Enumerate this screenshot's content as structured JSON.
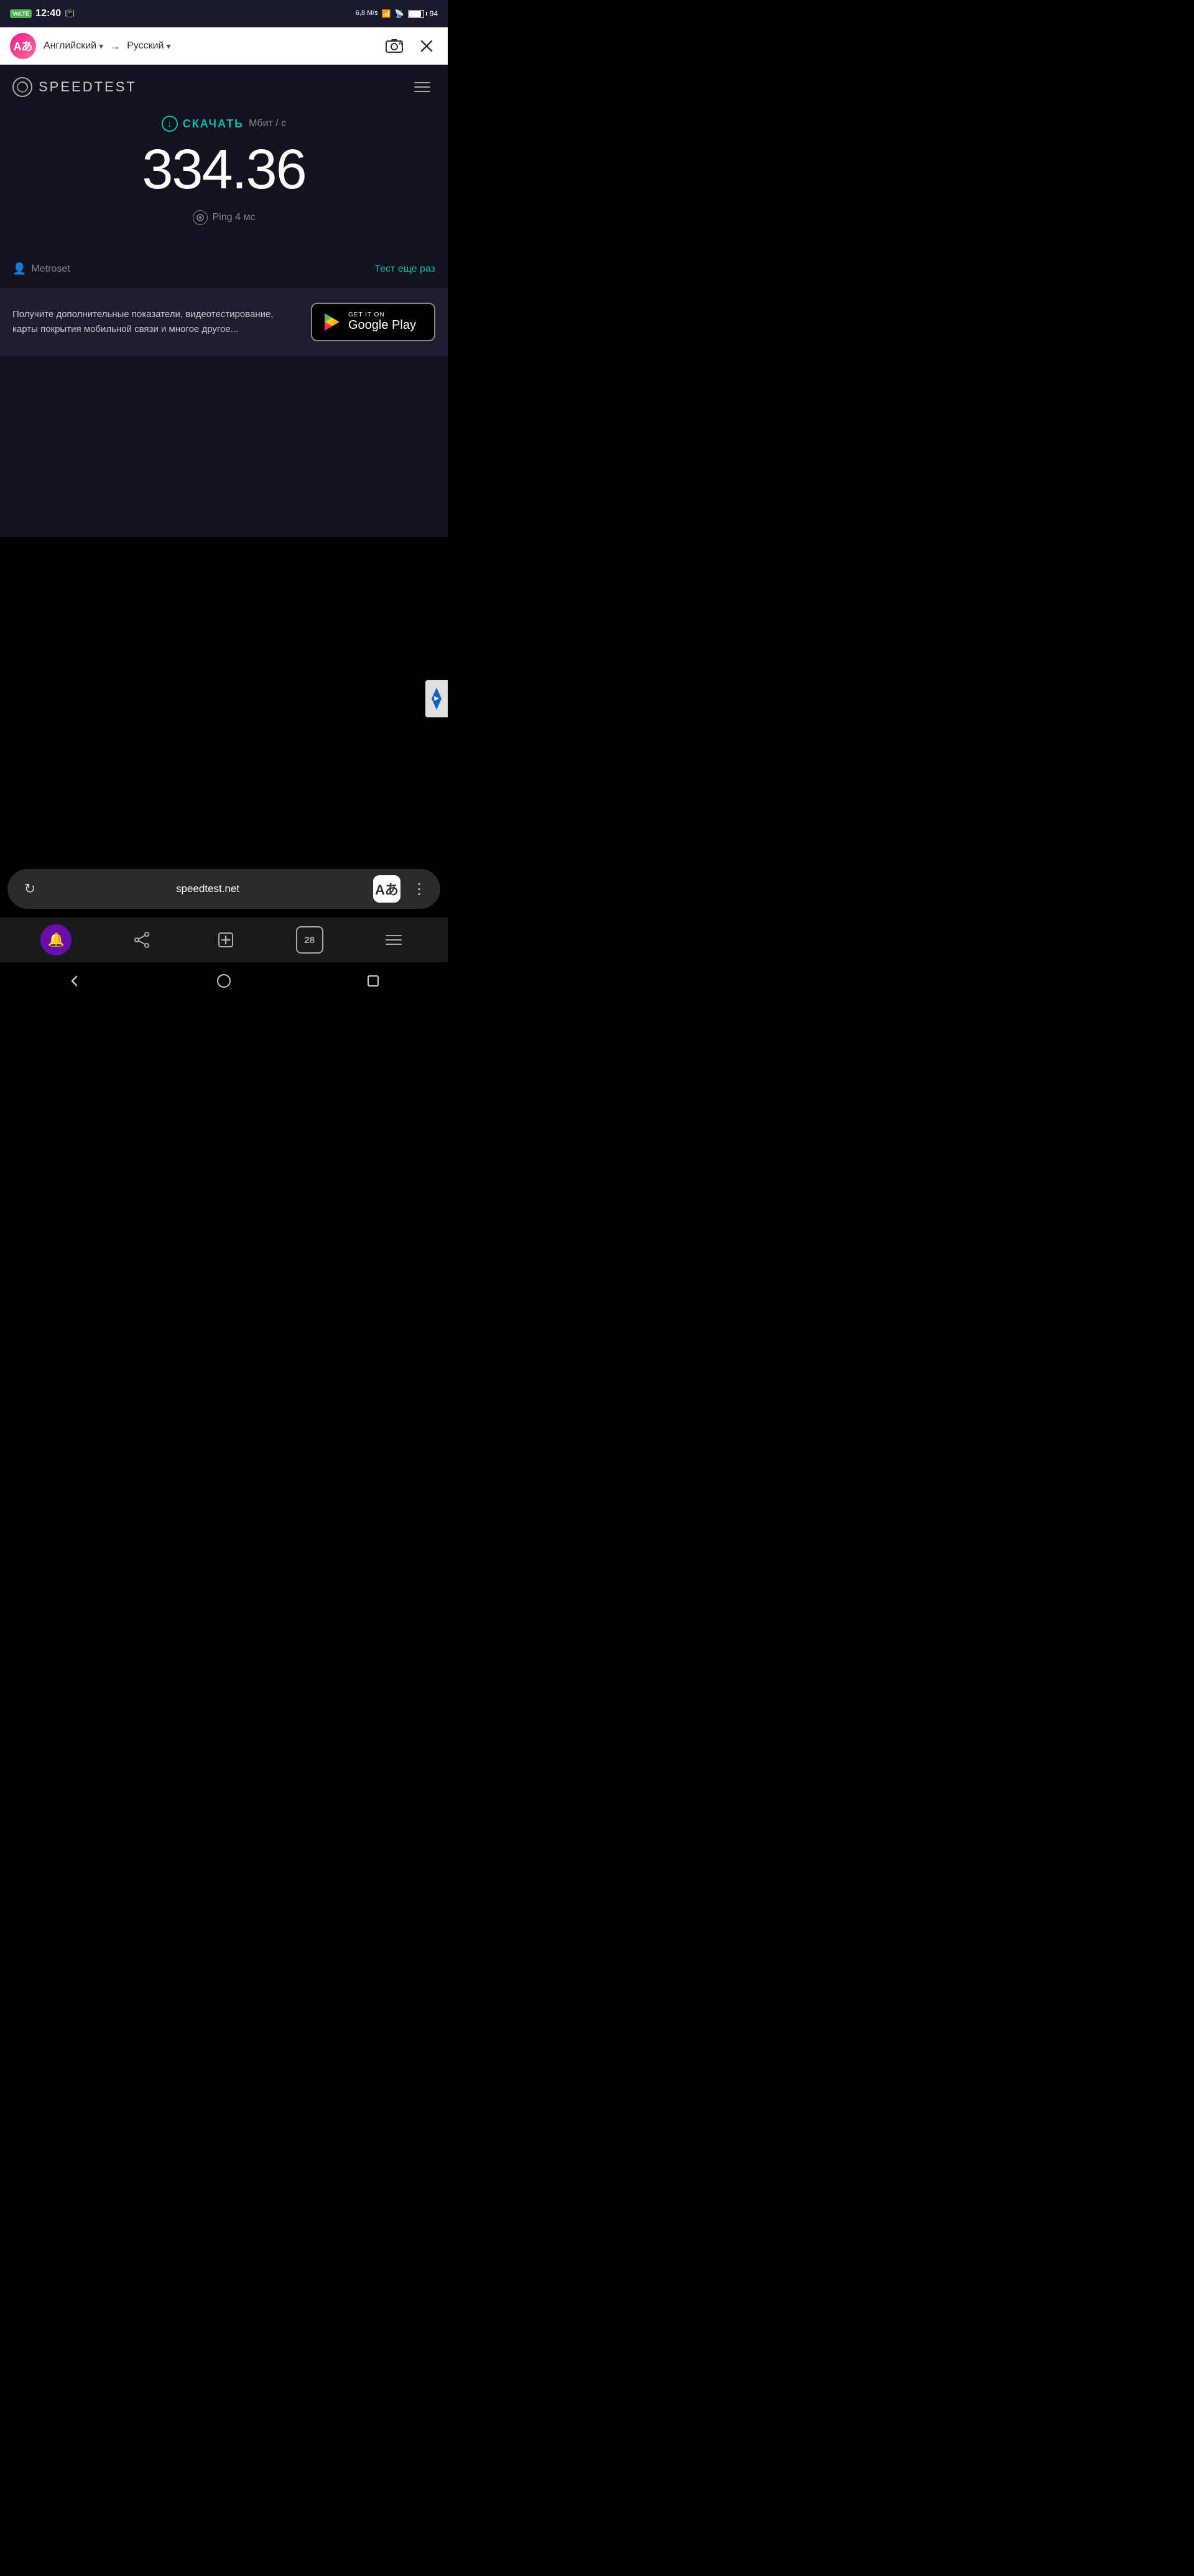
{
  "status_bar": {
    "volte": "VoLTE",
    "time": "12:40",
    "signal_icon": "📶",
    "speed": "6,8 M/s",
    "battery_percent": "94"
  },
  "translation_bar": {
    "avatar_letter": "Aあ",
    "source_lang": "Английский",
    "target_lang": "Русский",
    "arrow": "→",
    "chevron": "▾",
    "close_label": "×"
  },
  "speedtest": {
    "logo_text": "SPEEDTEST",
    "download_label": "СКАЧАТЬ",
    "download_unit": "Мбит / с",
    "speed_value": "334.36",
    "ping_label": "Ping 4 мс",
    "server_name": "Metroset",
    "retry_label": "Тест еще раз",
    "promo_text": "Получите дополнительные показатели, видеотестирование, карты покрытия мобильной связи и многое другое...",
    "google_play_get_it_on": "GET IT ON",
    "google_play_label": "Google Play"
  },
  "browser_bar": {
    "url": "speedtest.net",
    "translate_icon": "Aあ",
    "more_icon": "⋮"
  },
  "nav_row": {
    "tabs_count": "28"
  },
  "system_nav": {
    "back": "‹",
    "home": "",
    "recent": ""
  }
}
